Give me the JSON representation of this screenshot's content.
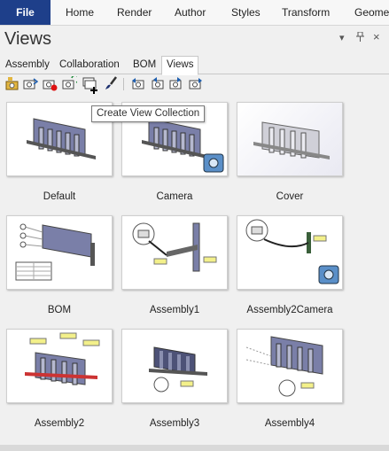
{
  "ribbon": {
    "items": [
      "File",
      "Home",
      "Render",
      "Author",
      "Styles",
      "Transform",
      "Geomet"
    ]
  },
  "panel": {
    "title": "Views"
  },
  "tabs": [
    "Assembly",
    "Collaboration",
    "BOM",
    "Views"
  ],
  "active_tab": "Views",
  "tooltip": "Create View Collection",
  "views": [
    {
      "label": "Default"
    },
    {
      "label": "Camera"
    },
    {
      "label": "Cover"
    },
    {
      "label": "BOM"
    },
    {
      "label": "Assembly1"
    },
    {
      "label": "Assembly2Camera"
    },
    {
      "label": "Assembly2"
    },
    {
      "label": "Assembly3"
    },
    {
      "label": "Assembly4"
    }
  ]
}
